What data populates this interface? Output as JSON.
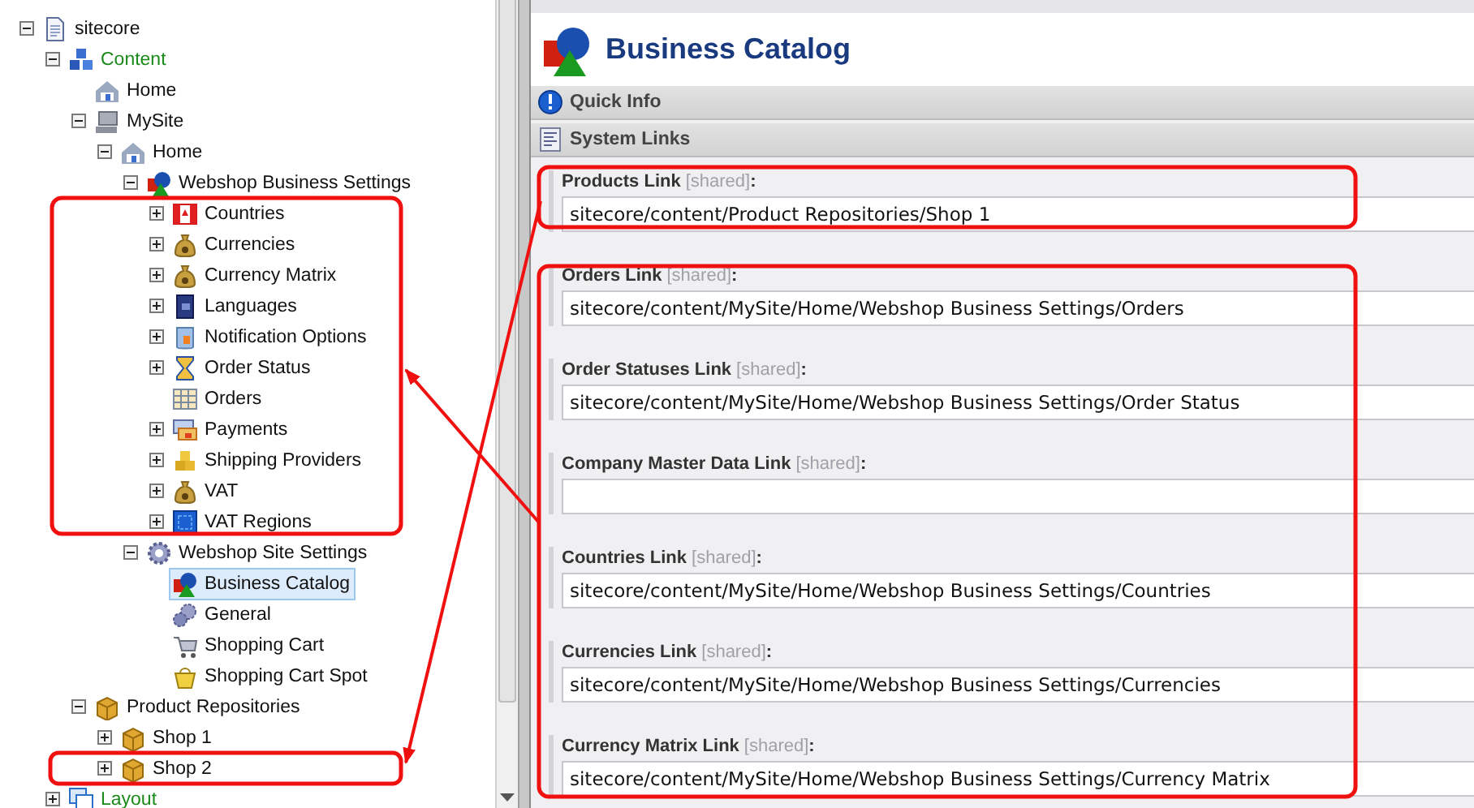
{
  "tree": [
    {
      "label": "sitecore",
      "kind": "document",
      "expanded": true,
      "selected": false,
      "children": [
        {
          "label": "Content",
          "kind": "cubes",
          "expanded": true,
          "selected": false,
          "children": [
            {
              "label": "Home",
              "kind": "house",
              "selected": false
            },
            {
              "label": "MySite",
              "kind": "computer",
              "expanded": true,
              "selected": false,
              "children": [
                {
                  "label": "Home",
                  "kind": "house",
                  "expanded": true,
                  "selected": false,
                  "children": [
                    {
                      "label": "Webshop Business Settings",
                      "kind": "shapes",
                      "expanded": true,
                      "selected": false,
                      "children": [
                        {
                          "label": "Countries",
                          "kind": "flag",
                          "expanded": false,
                          "selected": false
                        },
                        {
                          "label": "Currencies",
                          "kind": "moneybag",
                          "expanded": false,
                          "selected": false
                        },
                        {
                          "label": "Currency Matrix",
                          "kind": "moneybag",
                          "expanded": false,
                          "selected": false
                        },
                        {
                          "label": "Languages",
                          "kind": "book",
                          "expanded": false,
                          "selected": false
                        },
                        {
                          "label": "Notification Options",
                          "kind": "container",
                          "expanded": false,
                          "selected": false
                        },
                        {
                          "label": "Order Status",
                          "kind": "hourglass",
                          "expanded": false,
                          "selected": false
                        },
                        {
                          "label": "Orders",
                          "kind": "grid",
                          "selected": false
                        },
                        {
                          "label": "Payments",
                          "kind": "cards",
                          "expanded": false,
                          "selected": false
                        },
                        {
                          "label": "Shipping Providers",
                          "kind": "stack",
                          "expanded": false,
                          "selected": false
                        },
                        {
                          "label": "VAT",
                          "kind": "moneybag",
                          "expanded": false,
                          "selected": false
                        },
                        {
                          "label": "VAT Regions",
                          "kind": "square",
                          "expanded": false,
                          "selected": false
                        }
                      ]
                    },
                    {
                      "label": "Webshop Site Settings",
                      "kind": "gear",
                      "expanded": true,
                      "selected": false,
                      "children": [
                        {
                          "label": "Business Catalog",
                          "kind": "shapes",
                          "selected": true
                        },
                        {
                          "label": "General",
                          "kind": "gears",
                          "selected": false
                        },
                        {
                          "label": "Shopping Cart",
                          "kind": "cart",
                          "selected": false
                        },
                        {
                          "label": "Shopping Cart Spot",
                          "kind": "basket",
                          "selected": false
                        }
                      ]
                    }
                  ]
                }
              ]
            },
            {
              "label": "Product Repositories",
              "kind": "package",
              "expanded": true,
              "selected": false,
              "children": [
                {
                  "label": "Shop 1",
                  "kind": "package",
                  "expanded": false,
                  "selected": false
                },
                {
                  "label": "Shop 2",
                  "kind": "package",
                  "expanded": false,
                  "selected": false
                }
              ]
            }
          ]
        },
        {
          "label": "Layout",
          "kind": "windows",
          "expanded": false,
          "selected": false
        }
      ]
    }
  ],
  "editor": {
    "title": "Business Catalog",
    "sections": [
      {
        "title": "Quick Info",
        "kind": "info"
      },
      {
        "title": "System Links",
        "kind": "links"
      }
    ],
    "fields": [
      {
        "label": "Products Link",
        "tag": "[shared]",
        "separator": ":",
        "value": "sitecore/content/Product Repositories/Shop 1"
      },
      {
        "label": "Orders Link",
        "tag": "[shared]",
        "separator": ":",
        "value": "sitecore/content/MySite/Home/Webshop Business Settings/Orders"
      },
      {
        "label": "Order Statuses Link",
        "tag": "[shared]",
        "separator": ":",
        "value": "sitecore/content/MySite/Home/Webshop Business Settings/Order Status"
      },
      {
        "label": "Company Master Data Link",
        "tag": "[shared]",
        "separator": ":"
      },
      {
        "label": "Countries Link",
        "tag": "[shared]",
        "separator": ":",
        "value": "sitecore/content/MySite/Home/Webshop Business Settings/Countries"
      },
      {
        "label": "Currencies Link",
        "tag": "[shared]",
        "separator": ":",
        "value": "sitecore/content/MySite/Home/Webshop Business Settings/Currencies"
      },
      {
        "label": "Currency Matrix Link",
        "tag": "[shared]",
        "separator": ":",
        "value": "sitecore/content/MySite/Home/Webshop Business Settings/Currency Matrix"
      }
    ]
  }
}
